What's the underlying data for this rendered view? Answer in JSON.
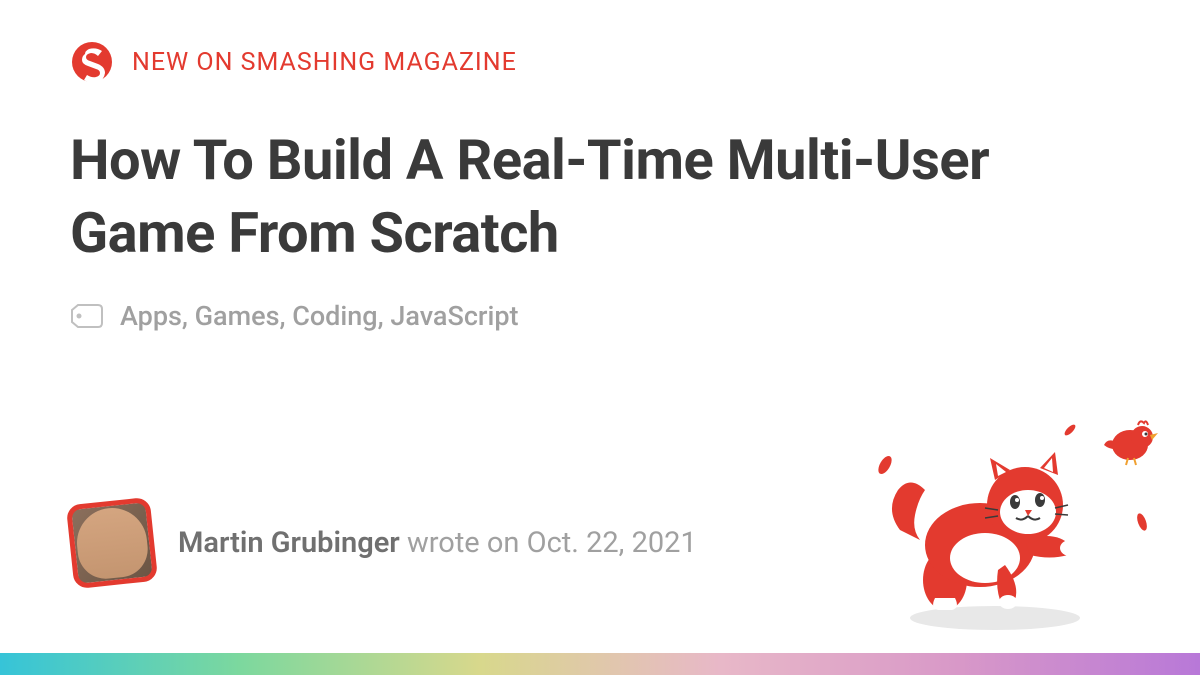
{
  "header": {
    "eyebrow": "NEW ON SMASHING MAGAZINE"
  },
  "article": {
    "title": "How To Build A Real-Time Multi-User Game From Scratch",
    "tags": "Apps, Games, Coding, JavaScript"
  },
  "author": {
    "name": "Martin Grubinger",
    "wrote_on_prefix": " wrote on ",
    "date": "Oct. 22, 2021"
  },
  "colors": {
    "brand_red": "#e33a2f",
    "text_dark": "#3a3a3a",
    "text_muted": "#a0a0a0"
  }
}
